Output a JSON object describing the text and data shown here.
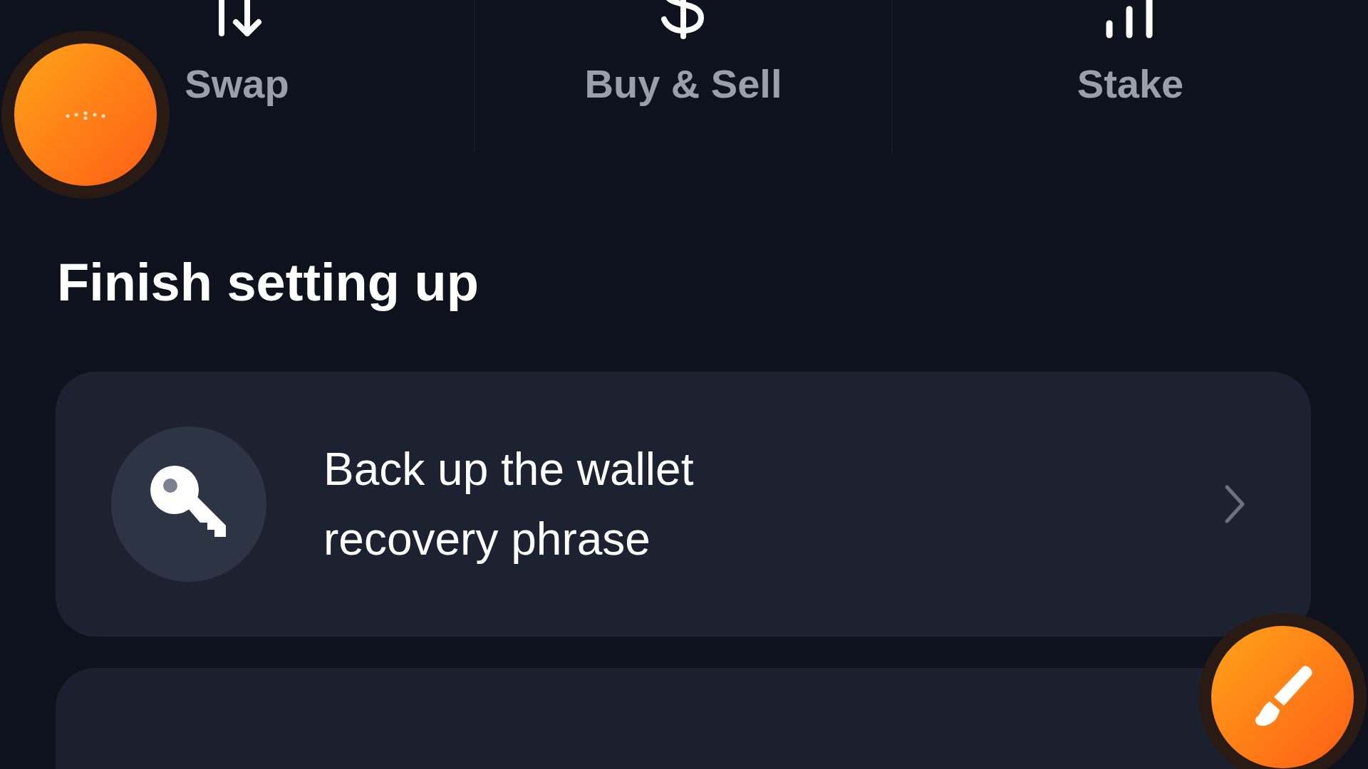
{
  "actions": [
    {
      "kind": "swap",
      "label": "Swap"
    },
    {
      "kind": "buy",
      "label": "Buy & Sell"
    },
    {
      "kind": "stake",
      "label": "Stake"
    }
  ],
  "section": {
    "title": "Finish setting up"
  },
  "tasks": [
    {
      "kind": "backup",
      "title": "Back up the wallet recovery phrase"
    }
  ]
}
